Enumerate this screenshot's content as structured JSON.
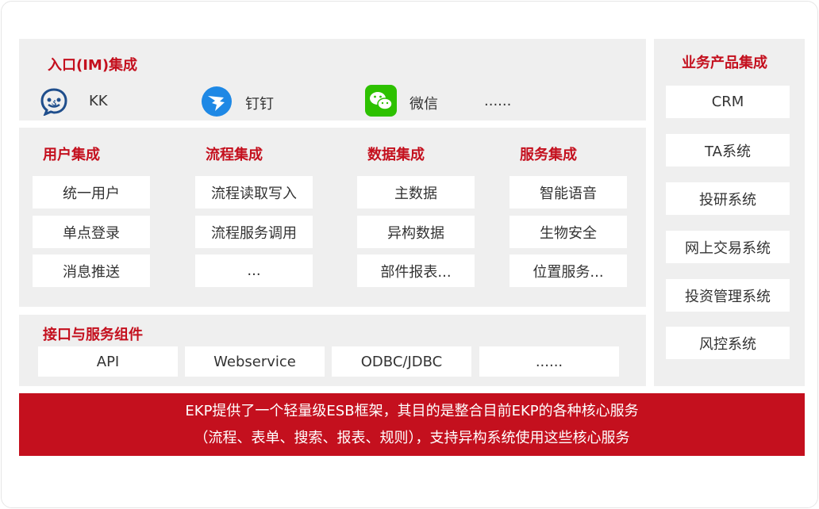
{
  "im": {
    "title": "入口(IM)集成",
    "items": [
      {
        "label": "KK",
        "icon": "kk-logo-icon"
      },
      {
        "label": "钉钉",
        "icon": "dingtalk-logo-icon"
      },
      {
        "label": "微信",
        "icon": "wechat-logo-icon"
      },
      {
        "label": "......"
      }
    ]
  },
  "integration": {
    "columns": [
      {
        "title": "用户集成",
        "items": [
          "统一用户",
          "单点登录",
          "消息推送"
        ]
      },
      {
        "title": "流程集成",
        "items": [
          "流程读取写入",
          "流程服务调用",
          "..."
        ]
      },
      {
        "title": "数据集成",
        "items": [
          "主数据",
          "异构数据",
          "部件报表..."
        ]
      },
      {
        "title": "服务集成",
        "items": [
          "智能语音",
          "生物安全",
          "位置服务..."
        ]
      }
    ]
  },
  "interface": {
    "title": "接口与服务组件",
    "items": [
      "API",
      "Webservice",
      "ODBC/JDBC",
      "......"
    ]
  },
  "business": {
    "title": "业务产品集成",
    "items": [
      "CRM",
      "TA系统",
      "投研系统",
      "网上交易系统",
      "投资管理系统",
      "风控系统"
    ]
  },
  "banner": {
    "line1": "EKP提供了一个轻量级ESB框架，其目的是整合目前EKP的各种核心服务",
    "line2": "（流程、表单、搜索、报表、规则），支持异构系统使用这些核心服务"
  },
  "colors": {
    "accent": "#c4101e",
    "panel": "#efefef",
    "dingtalk": "#1e88e5",
    "wechat": "#2dc100",
    "kk": "#1f4e8c"
  }
}
